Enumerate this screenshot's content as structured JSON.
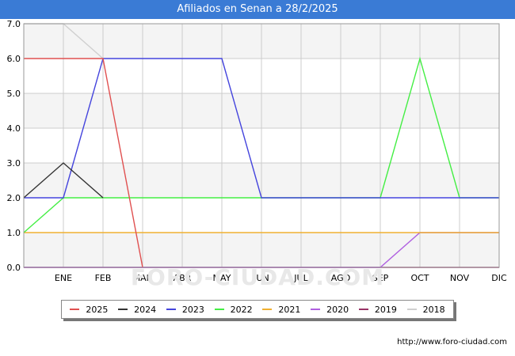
{
  "page": {
    "title": "Afiliados en Senan a 28/2/2025",
    "footer_url": "http://www.foro-ciudad.com",
    "watermark": "FORO-CIUDAD.COM"
  },
  "colors": {
    "title_bg": "#3a7bd5",
    "plot_bg": "#f4f4f4",
    "grid": "#cccccc"
  },
  "chart_data": {
    "type": "line",
    "title": "Afiliados en Senan a 28/2/2025",
    "categories": [
      "",
      "ENE",
      "FEB",
      "MAR",
      "ABR",
      "MAY",
      "JUN",
      "JUL",
      "AGO",
      "SEP",
      "OCT",
      "NOV",
      "DIC"
    ],
    "y_ticks": [
      "0.0",
      "1.0",
      "2.0",
      "3.0",
      "4.0",
      "5.0",
      "6.0",
      "7.0"
    ],
    "ylim": [
      0,
      7
    ],
    "grid": true,
    "legend_position": "bottom",
    "series": [
      {
        "name": "2025",
        "color": "#e05050",
        "values": [
          6,
          6,
          6,
          0
        ]
      },
      {
        "name": "2024",
        "color": "#333333",
        "values": [
          2,
          3,
          2
        ]
      },
      {
        "name": "2023",
        "color": "#4444dd",
        "values": [
          2,
          2,
          6,
          6,
          6,
          6,
          2,
          2,
          2,
          2,
          2,
          2,
          2
        ]
      },
      {
        "name": "2022",
        "color": "#44ee44",
        "values": [
          1,
          2,
          2,
          2,
          2,
          2,
          2,
          2,
          2,
          2,
          6,
          2,
          2
        ]
      },
      {
        "name": "2021",
        "color": "#f0b030",
        "values": [
          1,
          1,
          1,
          1,
          1,
          1,
          1,
          1,
          1,
          1,
          1,
          1,
          1
        ]
      },
      {
        "name": "2020",
        "color": "#b060e0",
        "values": [
          0,
          0,
          0,
          0,
          0,
          0,
          0,
          0,
          0,
          0,
          1,
          1,
          1
        ]
      },
      {
        "name": "2019",
        "color": "#993366",
        "values": [
          0,
          0,
          0,
          0,
          0,
          0,
          0,
          0,
          0,
          0,
          0,
          0,
          0
        ]
      },
      {
        "name": "2018",
        "color": "#d0d0d0",
        "values": [
          7,
          7,
          6
        ]
      }
    ]
  }
}
